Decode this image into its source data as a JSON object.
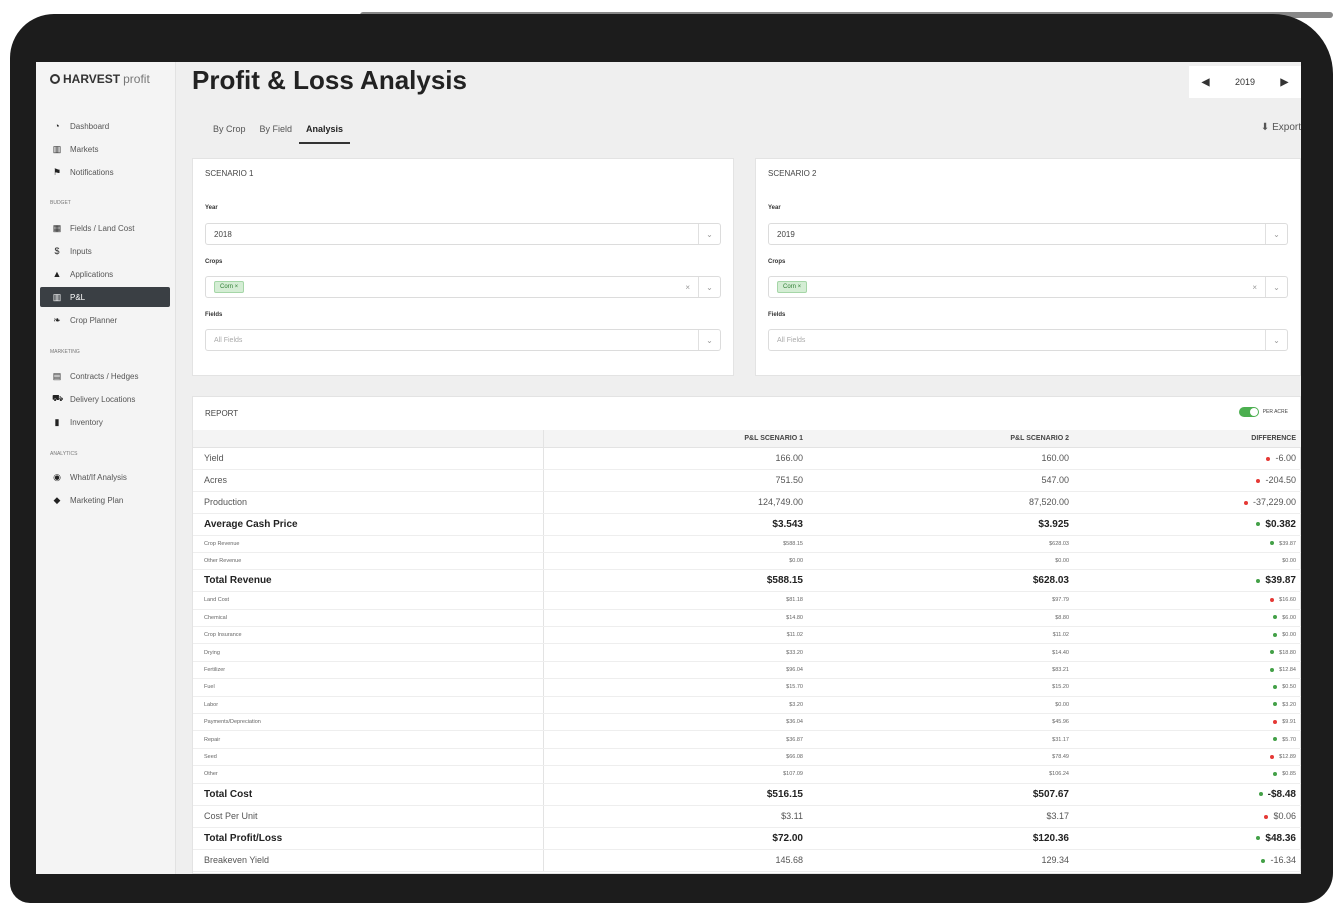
{
  "app": {
    "brand_bold": "HARVEST",
    "brand_light": "profit",
    "title": "Profit & Loss Analysis",
    "year": "2019",
    "export_label": "Export",
    "accent_color": "#4caf50"
  },
  "sidebar": {
    "items_top": [
      {
        "label": "Dashboard",
        "icon": "speedometer-icon"
      },
      {
        "label": "Markets",
        "icon": "chart-icon"
      },
      {
        "label": "Notifications",
        "icon": "flag-icon"
      }
    ],
    "section_budget": "BUDGET",
    "items_budget": [
      {
        "label": "Fields / Land Cost",
        "icon": "map-icon"
      },
      {
        "label": "Inputs",
        "icon": "dollar-icon"
      },
      {
        "label": "Applications",
        "icon": "flask-icon"
      },
      {
        "label": "P&L",
        "icon": "bar-chart-icon",
        "active": true
      },
      {
        "label": "Crop Planner",
        "icon": "leaf-icon"
      }
    ],
    "section_marketing": "MARKETING",
    "items_marketing": [
      {
        "label": "Contracts / Hedges",
        "icon": "document-icon"
      },
      {
        "label": "Delivery Locations",
        "icon": "truck-icon"
      },
      {
        "label": "Inventory",
        "icon": "inventory-icon"
      }
    ],
    "section_analytics": "ANALYTICS",
    "items_analytics": [
      {
        "label": "What/If Analysis",
        "icon": "globe-icon"
      },
      {
        "label": "Marketing Plan",
        "icon": "tag-icon"
      }
    ]
  },
  "tabs": [
    {
      "label": "By Crop"
    },
    {
      "label": "By Field"
    },
    {
      "label": "Analysis",
      "active": true
    }
  ],
  "scenario1": {
    "title": "SCENARIO 1",
    "year_label": "Year",
    "year_value": "2018",
    "crops_label": "Crops",
    "crop_chip": "Corn ×",
    "fields_label": "Fields",
    "fields_placeholder": "All Fields"
  },
  "scenario2": {
    "title": "SCENARIO 2",
    "year_label": "Year",
    "year_value": "2019",
    "crops_label": "Crops",
    "crop_chip": "Corn ×",
    "fields_label": "Fields",
    "fields_placeholder": "All Fields"
  },
  "report": {
    "title": "REPORT",
    "toggle_label": "PER ACRE",
    "columns": [
      "",
      "P&L SCENARIO 1",
      "P&L SCENARIO 2",
      "DIFFERENCE"
    ],
    "rows": [
      {
        "style": "main",
        "label": "Yield",
        "s1": "166.00",
        "s2": "160.00",
        "diff": "-6.00",
        "dir": "red"
      },
      {
        "style": "main",
        "label": "Acres",
        "s1": "751.50",
        "s2": "547.00",
        "diff": "-204.50",
        "dir": "red"
      },
      {
        "style": "main",
        "label": "Production",
        "s1": "124,749.00",
        "s2": "87,520.00",
        "diff": "-37,229.00",
        "dir": "red"
      },
      {
        "style": "bold",
        "label": "Average Cash Price",
        "s1": "$3.543",
        "s2": "$3.925",
        "diff": "$0.382",
        "dir": "green"
      },
      {
        "style": "sub",
        "label": "Crop Revenue",
        "s1": "$588.15",
        "s2": "$628.03",
        "diff": "$39.87",
        "dir": "green"
      },
      {
        "style": "sub",
        "label": "Other Revenue",
        "s1": "$0.00",
        "s2": "$0.00",
        "diff": "$0.00",
        "dir": ""
      },
      {
        "style": "bold",
        "label": "Total Revenue",
        "s1": "$588.15",
        "s2": "$628.03",
        "diff": "$39.87",
        "dir": "green"
      },
      {
        "style": "sub",
        "label": "Land Cost",
        "s1": "$81.18",
        "s2": "$97.79",
        "diff": "$16.60",
        "dir": "red"
      },
      {
        "style": "sub",
        "label": "Chemical",
        "s1": "$14.80",
        "s2": "$8.80",
        "diff": "$6.00",
        "dir": "green"
      },
      {
        "style": "sub",
        "label": "Crop Insurance",
        "s1": "$11.02",
        "s2": "$11.02",
        "diff": "$0.00",
        "dir": "green"
      },
      {
        "style": "sub",
        "label": "Drying",
        "s1": "$33.20",
        "s2": "$14.40",
        "diff": "$18.80",
        "dir": "green"
      },
      {
        "style": "sub",
        "label": "Fertilizer",
        "s1": "$96.04",
        "s2": "$83.21",
        "diff": "$12.84",
        "dir": "green"
      },
      {
        "style": "sub",
        "label": "Fuel",
        "s1": "$15.70",
        "s2": "$15.20",
        "diff": "$0.50",
        "dir": "green"
      },
      {
        "style": "sub",
        "label": "Labor",
        "s1": "$3.20",
        "s2": "$0.00",
        "diff": "$3.20",
        "dir": "green"
      },
      {
        "style": "sub",
        "label": "Payments/Depreciation",
        "s1": "$36.04",
        "s2": "$45.96",
        "diff": "$9.91",
        "dir": "red"
      },
      {
        "style": "sub",
        "label": "Repair",
        "s1": "$36.87",
        "s2": "$31.17",
        "diff": "$5.70",
        "dir": "green"
      },
      {
        "style": "sub",
        "label": "Seed",
        "s1": "$66.08",
        "s2": "$78.49",
        "diff": "$12.89",
        "dir": "red"
      },
      {
        "style": "sub",
        "label": "Other",
        "s1": "$107.09",
        "s2": "$106.24",
        "diff": "$0.85",
        "dir": "green"
      },
      {
        "style": "bold",
        "label": "Total Cost",
        "s1": "$516.15",
        "s2": "$507.67",
        "diff": "-$8.48",
        "dir": "green"
      },
      {
        "style": "main",
        "label": "Cost Per Unit",
        "s1": "$3.11",
        "s2": "$3.17",
        "diff": "$0.06",
        "dir": "red"
      },
      {
        "style": "bold",
        "label": "Total Profit/Loss",
        "s1": "$72.00",
        "s2": "$120.36",
        "diff": "$48.36",
        "dir": "green"
      },
      {
        "style": "main",
        "label": "Breakeven Yield",
        "s1": "145.68",
        "s2": "129.34",
        "diff": "-16.34",
        "dir": "green"
      }
    ]
  }
}
